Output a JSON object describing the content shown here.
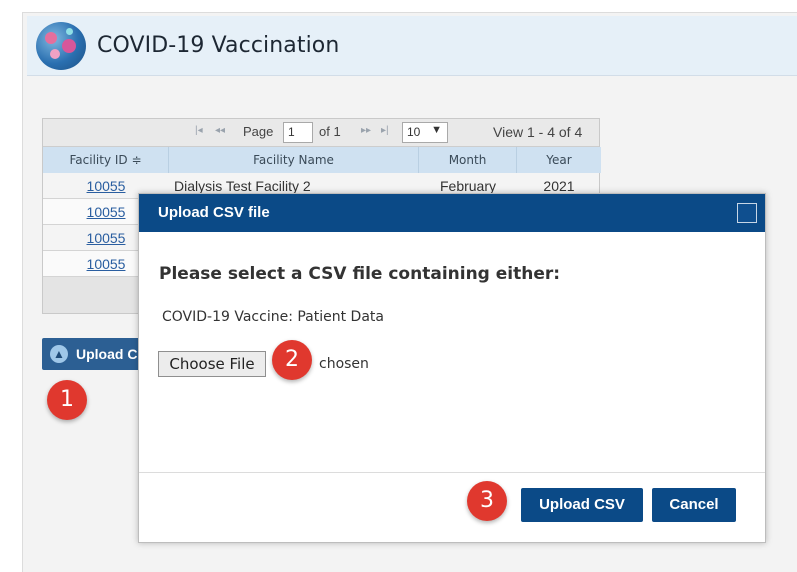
{
  "app": {
    "title": "COVID-19 Vaccination"
  },
  "grid": {
    "pager": {
      "first": "|◂",
      "prev": "◂◂",
      "page_label": "Page",
      "page_value": "1",
      "of_label": "of 1",
      "next": "▸▸",
      "last": "▸|",
      "rows_per_page": "10",
      "view_label": "View 1 - 4 of 4"
    },
    "columns": [
      "Facility ID ≑",
      "Facility Name",
      "Month",
      "Year"
    ],
    "rows": [
      {
        "facility_id": "10055",
        "facility_name": "Dialysis Test Facility 2",
        "month": "February",
        "year": "2021"
      },
      {
        "facility_id": "10055"
      },
      {
        "facility_id": "10055"
      },
      {
        "facility_id": "10055"
      }
    ]
  },
  "upload_button": {
    "icon": "up-arrow-icon",
    "label": "Upload C"
  },
  "modal": {
    "title": "Upload CSV file",
    "heading": "Please select a CSV file containing either:",
    "option": "COVID-19 Vaccine: Patient Data",
    "choose_file_label": "Choose File",
    "file_status": "chosen",
    "upload_label": "Upload CSV",
    "cancel_label": "Cancel"
  },
  "callouts": [
    "1",
    "2",
    "3"
  ],
  "colors": {
    "primary": "#0b4a87",
    "header_bg": "#e6f0f8",
    "grid_header": "#cfe1f1",
    "badge": "#e0382e",
    "link": "#2a5ea0"
  }
}
